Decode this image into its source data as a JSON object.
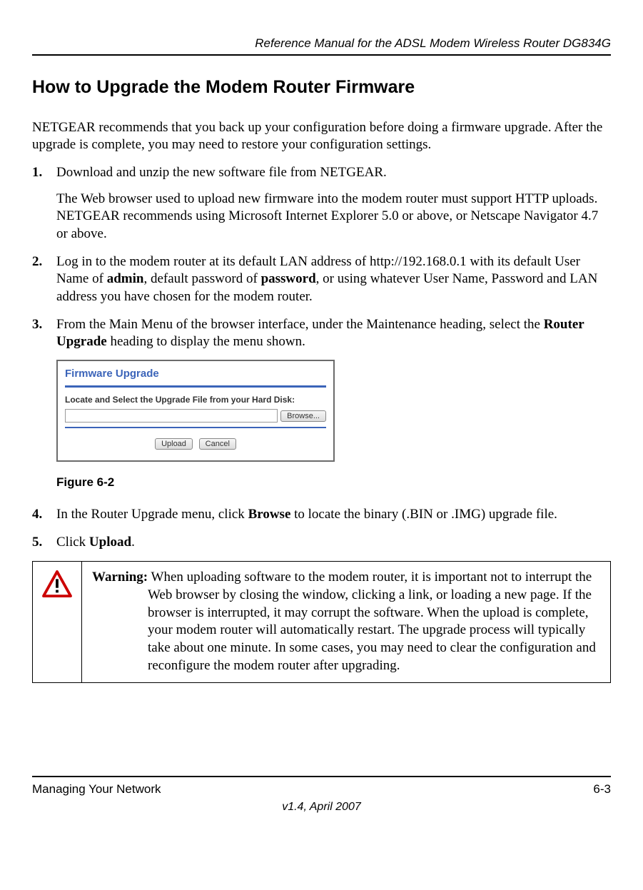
{
  "header": {
    "doc_title": "Reference Manual for the ADSL Modem Wireless Router DG834G"
  },
  "section": {
    "heading": "How to Upgrade the Modem Router Firmware",
    "intro": "NETGEAR recommends that you back up your configuration before doing a firmware upgrade. After the upgrade is complete, you may need to restore your configuration settings."
  },
  "steps": {
    "s1_p1": "Download and unzip the new software file from NETGEAR.",
    "s1_p2": "The Web browser used to upload new firmware into the modem router must support HTTP uploads. NETGEAR recommends using Microsoft Internet Explorer 5.0 or above, or Netscape Navigator 4.7 or above.",
    "s2_pre": "Log in to the modem router at its default LAN address of http://192.168.0.1 with its default User Name of ",
    "s2_admin": "admin",
    "s2_mid": ", default password of ",
    "s2_password": "password",
    "s2_post": ", or using whatever User Name, Password and LAN address you have chosen for the modem router.",
    "s3_pre": "From the Main Menu of the browser interface, under the Maintenance heading, select the ",
    "s3_bold": "Router Upgrade",
    "s3_post": " heading to display the menu shown.",
    "s4_pre": "In the Router Upgrade menu, click ",
    "s4_bold": "Browse",
    "s4_post": " to locate the binary (.BIN or .IMG) upgrade file.",
    "s5_pre": "Click ",
    "s5_bold": "Upload",
    "s5_post": "."
  },
  "figure": {
    "panel_title": "Firmware Upgrade",
    "field_label": "Locate and Select the Upgrade File from your Hard Disk:",
    "browse_btn": "Browse...",
    "upload_btn": "Upload",
    "cancel_btn": "Cancel",
    "caption": "Figure 6-2"
  },
  "warning": {
    "label": "Warning:",
    "text": " When uploading software to the modem router, it is important not to interrupt the Web browser by closing the window, clicking a link, or loading a new page. If the browser is interrupted, it may corrupt the software. When the upload is complete, your modem router will automatically restart. The upgrade process will typically take about one minute. In some cases, you may need to clear the configuration and reconfigure the modem router after upgrading."
  },
  "footer": {
    "section_name": "Managing Your Network",
    "page_num": "6-3",
    "version": "v1.4, April 2007"
  }
}
